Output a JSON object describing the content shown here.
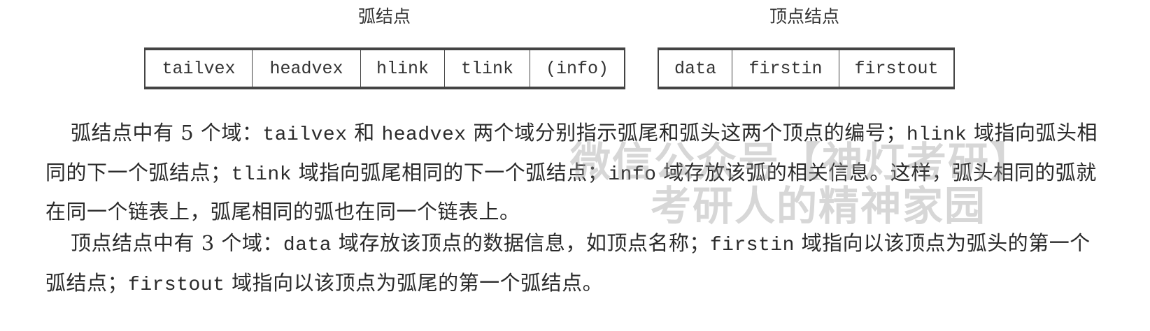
{
  "arc_node": {
    "title": "弧结点",
    "fields": [
      "tailvex",
      "headvex",
      "hlink",
      "tlink",
      "(info)"
    ]
  },
  "vertex_node": {
    "title": "顶点结点",
    "fields": [
      "data",
      "firstin",
      "firstout"
    ]
  },
  "paragraphs": [
    {
      "parts": [
        "弧结点中有 5 个域：",
        "tailvex",
        " 和 ",
        "headvex",
        " 两个域分别指示弧尾和弧头这两个顶点的编号；",
        "hlink",
        " 域指向弧头相同的下一个弧结点；",
        "tlink",
        " 域指向弧尾相同的下一个弧结点；",
        "info",
        " 域存放该弧的相关信息。这样，弧头相同的弧就在同一个链表上，弧尾相同的弧也在同一个链表上。"
      ]
    },
    {
      "parts": [
        "顶点结点中有 3 个域：",
        "data",
        " 域存放该顶点的数据信息，如顶点名称；",
        "firstin",
        " 域指向以该顶点为弧头的第一个弧结点；",
        "firstout",
        " 域指向以该顶点为弧尾的第一个弧结点。"
      ]
    }
  ],
  "watermark": {
    "line1": "微信公众号【神灯考研】",
    "line2": "考研人的精神家园"
  }
}
